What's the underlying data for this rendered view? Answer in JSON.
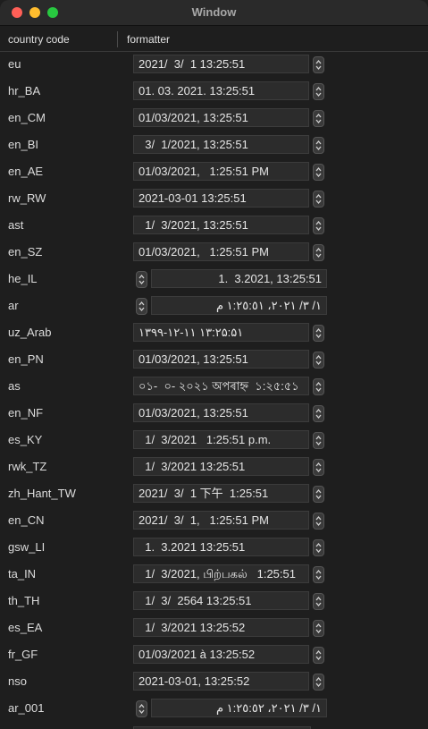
{
  "window": {
    "title": "Window"
  },
  "table": {
    "headers": {
      "country_code": "country code",
      "formatter": "formatter"
    },
    "rows": [
      {
        "code": "eu",
        "value": "2021/  3/  1 13:25:51",
        "dir": "ltr"
      },
      {
        "code": "hr_BA",
        "value": "01. 03. 2021. 13:25:51",
        "dir": "ltr"
      },
      {
        "code": "en_CM",
        "value": "01/03/2021, 13:25:51",
        "dir": "ltr"
      },
      {
        "code": "en_BI",
        "value": "  3/  1/2021, 13:25:51",
        "dir": "ltr"
      },
      {
        "code": "en_AE",
        "value": "01/03/2021,   1:25:51 PM",
        "dir": "ltr"
      },
      {
        "code": "rw_RW",
        "value": "2021-03-01 13:25:51",
        "dir": "ltr"
      },
      {
        "code": "ast",
        "value": "  1/  3/2021, 13:25:51",
        "dir": "ltr"
      },
      {
        "code": "en_SZ",
        "value": "01/03/2021,   1:25:51 PM",
        "dir": "ltr"
      },
      {
        "code": "he_IL",
        "value": "1.  3.2021, 13:25:51",
        "dir": "rtl"
      },
      {
        "code": "ar",
        "value": "١‏/ ٣‏/ ٢٠٢١، ١:٢٥:٥١ م",
        "dir": "rtl"
      },
      {
        "code": "uz_Arab",
        "value": "۱۳۹۹-۱۲-۱۱ ۱۳:۲۵:۵۱",
        "dir": "ltr"
      },
      {
        "code": "en_PN",
        "value": "01/03/2021, 13:25:51",
        "dir": "ltr"
      },
      {
        "code": "as",
        "value": "০১-  ০- ২০২১ অপৰাহ্ন  ১:২৫:৫১",
        "dir": "ltr"
      },
      {
        "code": "en_NF",
        "value": "01/03/2021, 13:25:51",
        "dir": "ltr"
      },
      {
        "code": "es_KY",
        "value": "  1/  3/2021   1:25:51 p.m.",
        "dir": "ltr"
      },
      {
        "code": "rwk_TZ",
        "value": "  1/  3/2021 13:25:51",
        "dir": "ltr"
      },
      {
        "code": "zh_Hant_TW",
        "value": "2021/  3/  1 下午  1:25:51",
        "dir": "ltr"
      },
      {
        "code": "en_CN",
        "value": "2021/  3/  1,   1:25:51 PM",
        "dir": "ltr"
      },
      {
        "code": "gsw_LI",
        "value": "  1.  3.2021 13:25:51",
        "dir": "ltr"
      },
      {
        "code": "ta_IN",
        "value": "  1/  3/2021, பிற்பகல்   1:25:51",
        "dir": "ltr"
      },
      {
        "code": "th_TH",
        "value": "  1/  3/  2564 13:25:51",
        "dir": "ltr"
      },
      {
        "code": "es_EA",
        "value": "  1/  3/2021 13:25:52",
        "dir": "ltr"
      },
      {
        "code": "fr_GF",
        "value": "01/03/2021 à 13:25:52",
        "dir": "ltr"
      },
      {
        "code": "nso",
        "value": "2021-03-01, 13:25:52",
        "dir": "ltr"
      },
      {
        "code": "ar_001",
        "value": "١‏/ ٣‏/ ٢٠٢١، ١:٢٥:٥٢ م",
        "dir": "rtl"
      }
    ]
  }
}
